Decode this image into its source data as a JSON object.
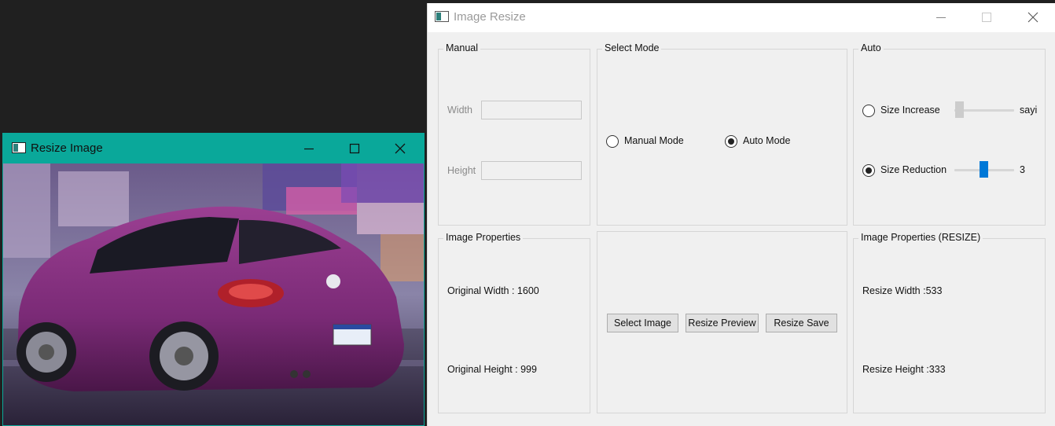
{
  "resize_image_window": {
    "title": "Resize Image",
    "title_bar_color": "#0aa89a"
  },
  "image_resize_window": {
    "title": "Image Resize",
    "manual_group": {
      "label": "Manual",
      "width_label": "Width",
      "width_value": "",
      "height_label": "Height",
      "height_value": ""
    },
    "mode_group": {
      "label": "Select Mode",
      "manual_mode_label": "Manual Mode",
      "manual_mode_checked": false,
      "auto_mode_label": "Auto Mode",
      "auto_mode_checked": true
    },
    "auto_group": {
      "label": "Auto",
      "size_increase_label": "Size Increase",
      "size_increase_checked": false,
      "size_increase_value": "sayi",
      "size_reduction_label": "Size Reduction",
      "size_reduction_checked": true,
      "size_reduction_value": "3"
    },
    "image_properties": {
      "label": "Image Properties",
      "original_width_text": "Original Width  : 1600",
      "original_height_text": "Original Height : 999"
    },
    "actions": {
      "select_image_label": "Select Image",
      "resize_preview_label": "Resize Preview",
      "resize_save_label": "Resize Save"
    },
    "resize_properties": {
      "label": "Image Properties (RESIZE)",
      "resize_width_text": "Resize Width  :533",
      "resize_height_text": "Resize Height :333"
    },
    "accent_color": "#0078d7"
  }
}
